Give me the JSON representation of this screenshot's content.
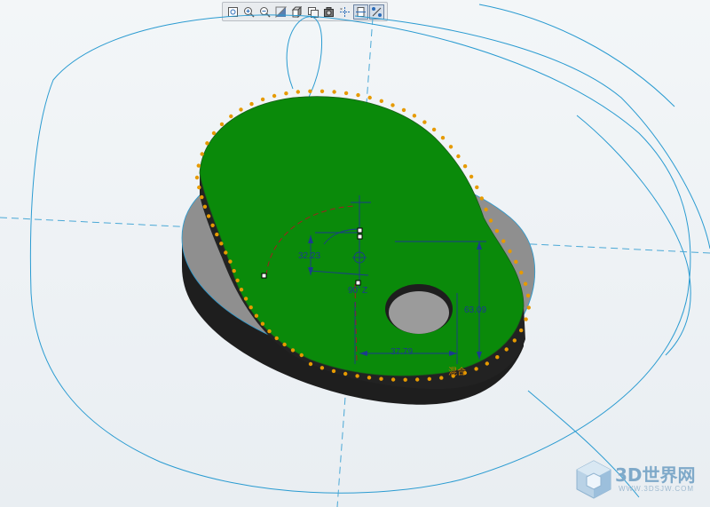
{
  "toolbar": {
    "buttons": [
      {
        "icon": "refit-icon",
        "title": "Refit"
      },
      {
        "icon": "zoom-in-icon",
        "title": "Zoom In"
      },
      {
        "icon": "zoom-out-icon",
        "title": "Zoom Out"
      },
      {
        "icon": "repaint-icon",
        "title": "Repaint"
      },
      {
        "icon": "shading-icon",
        "title": "Display Style"
      },
      {
        "icon": "saved-views-icon",
        "title": "Saved Orientations"
      },
      {
        "icon": "view-manager-icon",
        "title": "View Manager"
      },
      {
        "icon": "datum-display-icon",
        "title": "Datum Display"
      },
      {
        "icon": "sketch-orient-icon",
        "title": "Sketch View"
      },
      {
        "icon": "constraints-display-icon",
        "title": "Sketcher Display"
      }
    ]
  },
  "dimensions": {
    "radius": "32.23",
    "angle": "90",
    "angle_suffix": "Z",
    "height": "63.09",
    "width": "37.79",
    "note": "混合"
  },
  "colors": {
    "part_face": "#0a8a0a",
    "part_side": "#1e1e1e",
    "lower_face": "#8f8f8f",
    "curve": "#2a9bd1",
    "dimension": "#1b3a8f",
    "sketch_points": "#e69a00"
  },
  "watermark": {
    "title": "3D世界网",
    "url": "WWW.3DSJW.COM"
  }
}
